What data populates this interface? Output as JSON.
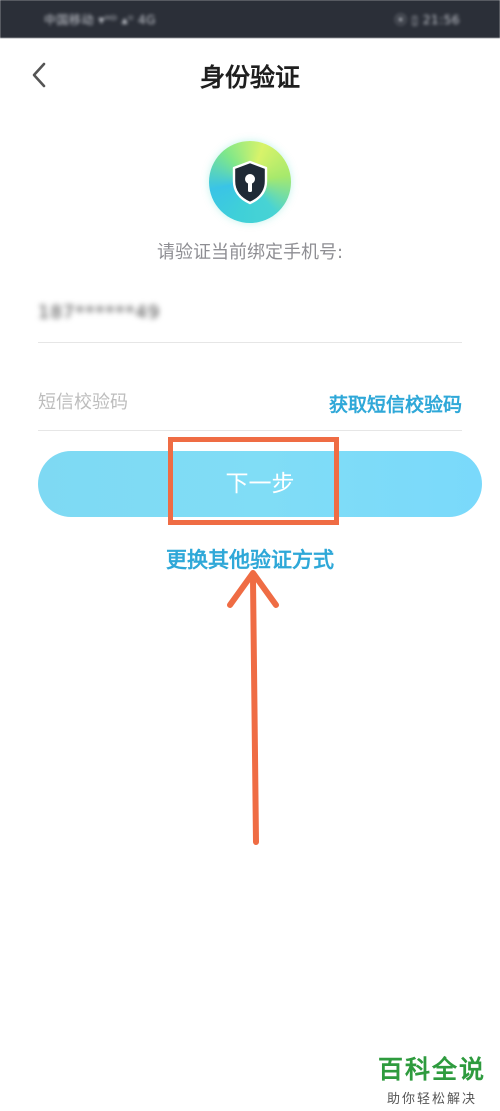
{
  "status_bar": {
    "left_text": "中国移动 ▾ᴴᴰ ▴ᴵᴵ 4G",
    "right_text": "⦿ ▯ 21:56"
  },
  "header": {
    "title": "身份验证",
    "back_icon": "chevron-left-icon"
  },
  "badge": {
    "icon": "shield-keyhole-icon",
    "colors": [
      "#3fd0d8",
      "#7fe78a",
      "#d8f36a"
    ]
  },
  "form": {
    "prompt": "请验证当前绑定手机号:",
    "phone_masked": "187******49",
    "sms_placeholder": "短信校验码",
    "get_code_label": "获取短信校验码",
    "next_label": "下一步",
    "switch_method_label": "更换其他验证方式"
  },
  "colors": {
    "accent": "#2fa8d8",
    "button": "#80ddf6",
    "annotation": "#ef6c44",
    "watermark": "#2e9b3e"
  },
  "watermark": {
    "main": "百科全说",
    "sub": "助你轻松解决"
  }
}
